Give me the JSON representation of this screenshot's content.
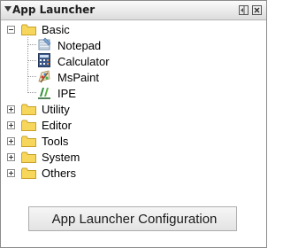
{
  "window": {
    "title": "App Launcher"
  },
  "tree": {
    "expanded_group": {
      "label": "Basic",
      "children": [
        {
          "label": "Notepad",
          "icon": "notepad-icon"
        },
        {
          "label": "Calculator",
          "icon": "calculator-icon"
        },
        {
          "label": "MsPaint",
          "icon": "paint-icon"
        },
        {
          "label": "IPE",
          "icon": "ipe-icon"
        }
      ]
    },
    "collapsed_groups": [
      {
        "label": "Utility"
      },
      {
        "label": "Editor"
      },
      {
        "label": "Tools"
      },
      {
        "label": "System"
      },
      {
        "label": "Others"
      }
    ]
  },
  "footer": {
    "config_label": "App Launcher Configuration"
  },
  "colors": {
    "folder_yellow": "#f7d65c",
    "folder_outline": "#c9a12a",
    "border": "#8c8c8c"
  }
}
